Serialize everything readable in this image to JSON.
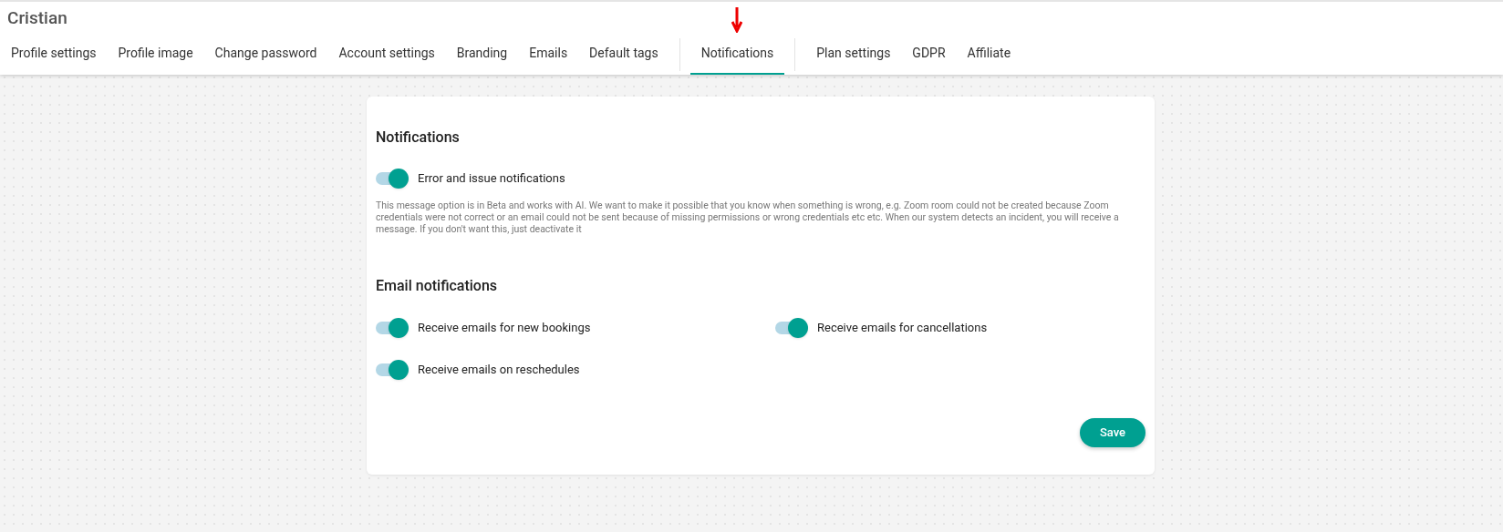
{
  "header": {
    "title": "Cristian"
  },
  "tab_groups": [
    [
      {
        "label": "Profile settings",
        "selected": false
      },
      {
        "label": "Profile image",
        "selected": false
      },
      {
        "label": "Change password",
        "selected": false
      },
      {
        "label": "Account settings",
        "selected": false
      },
      {
        "label": "Branding",
        "selected": false
      },
      {
        "label": "Emails",
        "selected": false
      },
      {
        "label": "Default tags",
        "selected": false
      }
    ],
    [
      {
        "label": "Notifications",
        "selected": true
      }
    ],
    [
      {
        "label": "Plan settings",
        "selected": false
      },
      {
        "label": "GDPR",
        "selected": false
      },
      {
        "label": "Affiliate",
        "selected": false
      }
    ]
  ],
  "notifications": {
    "heading": "Notifications",
    "toggle": {
      "label": "Error and issue notifications",
      "on": true
    },
    "description": "This message option is in Beta and works with AI. We want to make it possible that you know when something is wrong, e.g. Zoom room could not be created because Zoom credentials were not correct or an email could not be sent because of missing permissions or wrong credentials etc etc. When our system detects an incident, you will receive a message. If you don't want this, just deactivate it"
  },
  "email_notifications": {
    "heading": "Email notifications",
    "toggles": [
      {
        "label": "Receive emails for new bookings",
        "on": true
      },
      {
        "label": "Receive emails for cancellations",
        "on": true
      },
      {
        "label": "Receive emails on reschedules",
        "on": true
      }
    ]
  },
  "save_button": "Save"
}
